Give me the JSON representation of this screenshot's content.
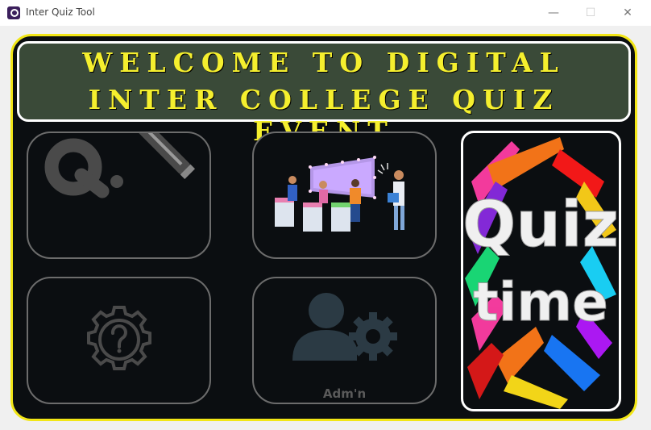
{
  "window": {
    "title": "Inter Quiz Tool",
    "app_icon": "quiz-app-icon",
    "controls": {
      "minimize": "—",
      "maximize": "☐",
      "close": "✕"
    }
  },
  "banner": {
    "line1": "WELCOME TO DIGITAL",
    "line2": "INTER COLLEGE QUIZ EVENT",
    "text_color": "#f5ef2e",
    "background": "#3a4a38"
  },
  "tiles": {
    "quiz": {
      "icon": "quiz-pencil-icon"
    },
    "players": {
      "icon": "quiz-show-players-icon"
    },
    "help": {
      "icon": "question-gear-icon"
    },
    "admin": {
      "icon": "admin-gear-icon",
      "label": "Adm'n"
    },
    "quiz_time": {
      "image": "quiz-time-image",
      "text_top": "Quiz",
      "text_bottom": "time"
    }
  },
  "colors": {
    "frame_border": "#f2e616",
    "frame_background": "#0b0e11",
    "tile_border": "#6c6c6c",
    "icon_gray": "#4a4a4a"
  }
}
